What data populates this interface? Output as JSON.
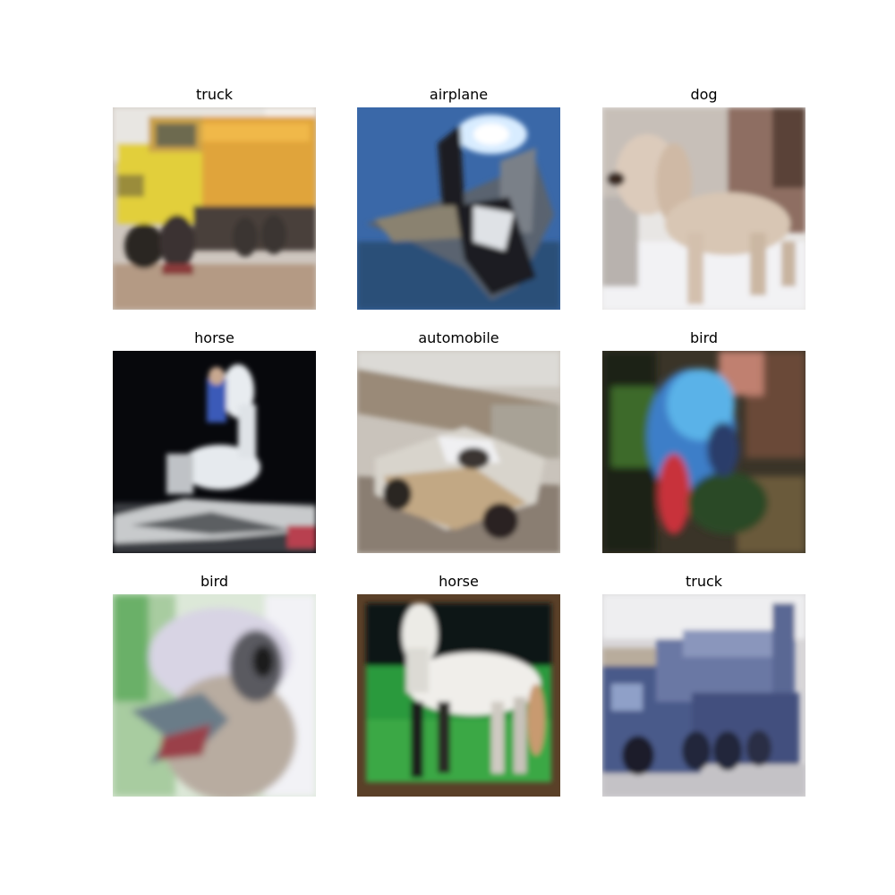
{
  "figure": {
    "panels": [
      {
        "label": "truck"
      },
      {
        "label": "airplane"
      },
      {
        "label": "dog"
      },
      {
        "label": "horse"
      },
      {
        "label": "automobile"
      },
      {
        "label": "bird"
      },
      {
        "label": "bird"
      },
      {
        "label": "horse"
      },
      {
        "label": "truck"
      }
    ]
  }
}
